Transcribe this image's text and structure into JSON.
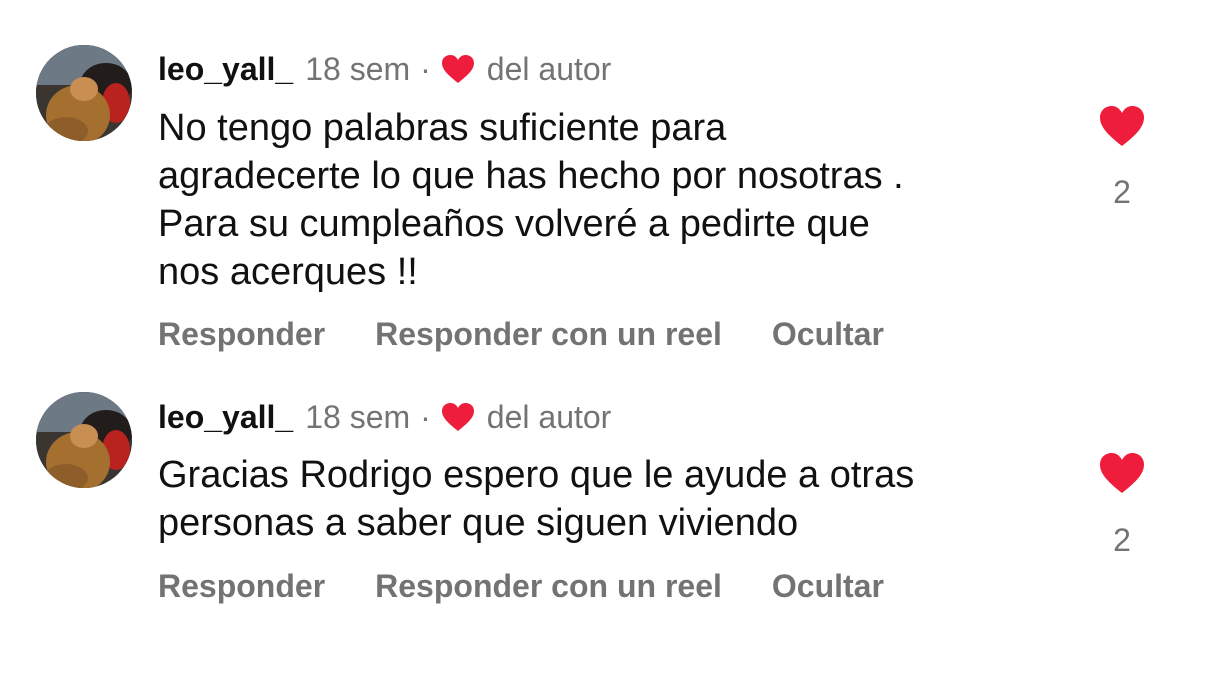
{
  "comments": [
    {
      "username": "leo_yall_",
      "time": "18 sem",
      "separator": "·",
      "author_label": "del autor",
      "text_lines": [
        "No tengo palabras suficiente para",
        "agradecerte lo que has hecho por nosotras .",
        "Para su cumpleaños volveré a pedirte que",
        "nos acerques !!"
      ],
      "actions": {
        "reply": "Responder",
        "reply_reel": "Responder con un reel",
        "hide": "Ocultar"
      },
      "likes": "2"
    },
    {
      "username": "leo_yall_",
      "time": "18 sem",
      "separator": "·",
      "author_label": "del autor",
      "text_lines": [
        "Gracias Rodrigo espero que le ayude a otras",
        "personas a saber que siguen viviendo"
      ],
      "actions": {
        "reply": "Responder",
        "reply_reel": "Responder con un reel",
        "hide": "Ocultar"
      },
      "likes": "2"
    }
  ],
  "colors": {
    "heart": "#ee1d3b",
    "secondary_text": "#737373",
    "primary_text": "#111111"
  },
  "icons": {
    "author_like": "heart-icon",
    "comment_like": "heart-icon"
  }
}
